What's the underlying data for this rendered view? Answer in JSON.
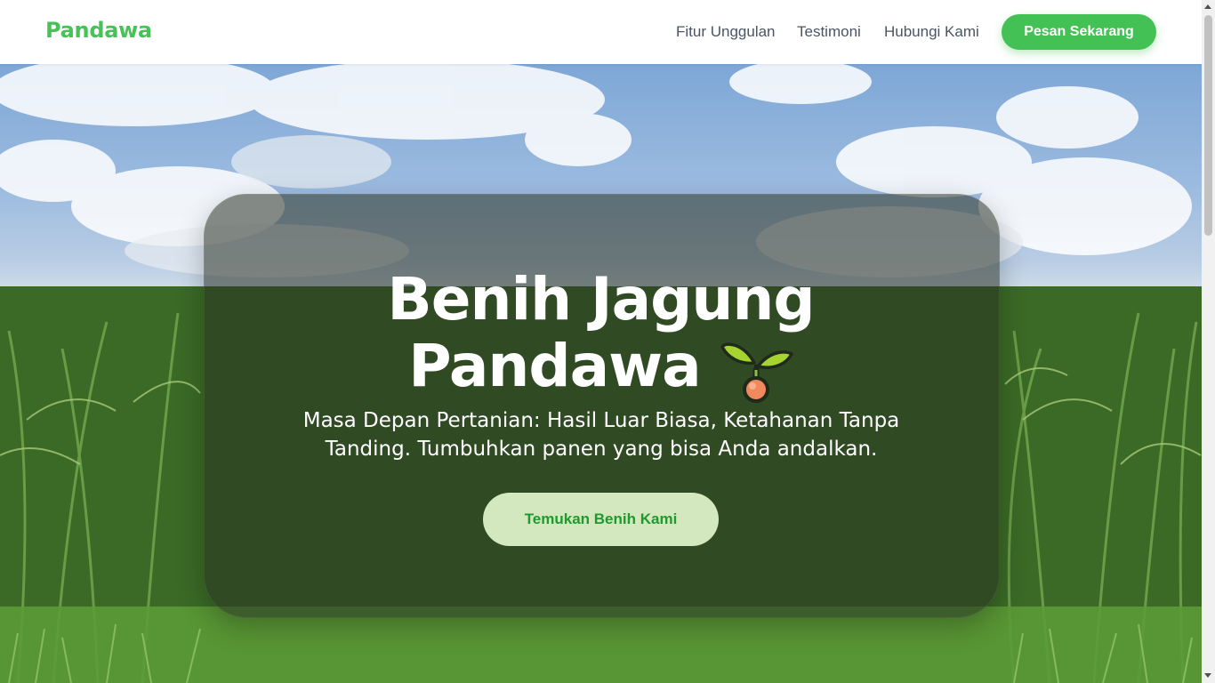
{
  "header": {
    "logo": "Pandawa",
    "nav": [
      "Fitur Unggulan",
      "Testimoni",
      "Hubungi Kami"
    ],
    "cta": "Pesan Sekarang"
  },
  "hero": {
    "title_line1": "Benih Jagung",
    "title_line2": "Pandawa",
    "title_icon": "sprout-icon",
    "subtitle": "Masa Depan Pertanian: Hasil Luar Biasa, Ketahanan Tanpa Tanding. Tumbuhkan panen yang bisa Anda andalkan.",
    "cta": "Temukan Benih Kami",
    "background": "corn-field-photo"
  },
  "colors": {
    "brand_green": "#46c257",
    "button_green": "#43c154",
    "hero_button_bg": "#d3e8bf",
    "hero_button_text": "#1f9a2e",
    "nav_text": "#4b5563"
  }
}
